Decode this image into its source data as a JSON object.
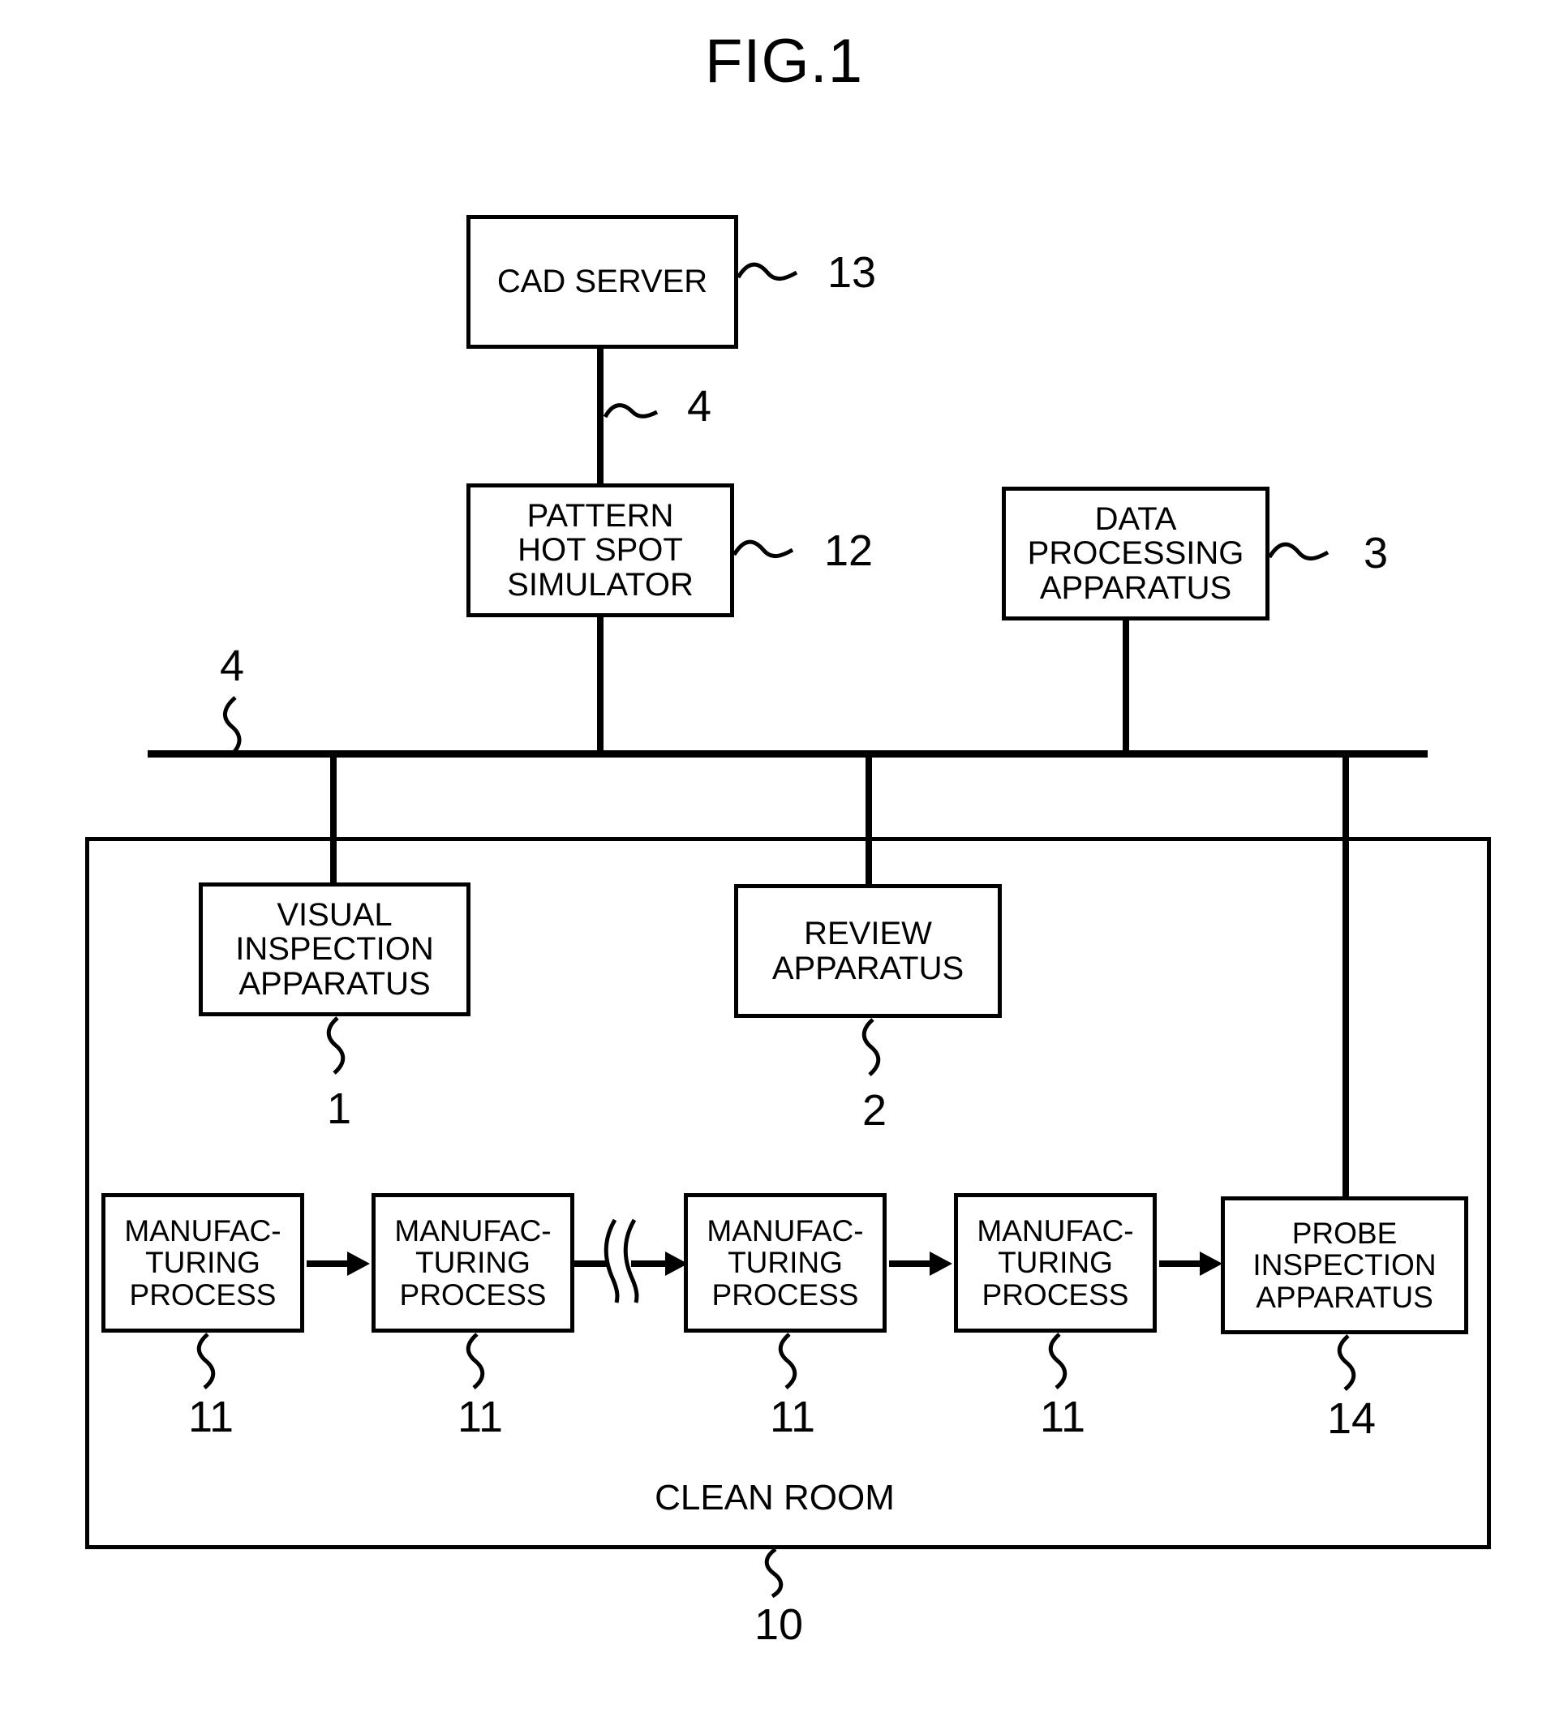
{
  "figure": {
    "title": "FIG.1"
  },
  "blocks": {
    "cad_server": {
      "lines": [
        "CAD SERVER"
      ],
      "ref": "13"
    },
    "pattern_hot_spot_simulator": {
      "lines": [
        "PATTERN",
        "HOT SPOT",
        "SIMULATOR"
      ],
      "ref": "12"
    },
    "data_processing_apparatus": {
      "lines": [
        "DATA",
        "PROCESSING",
        "APPARATUS"
      ],
      "ref": "3"
    },
    "visual_inspection_apparatus": {
      "lines": [
        "VISUAL",
        "INSPECTION",
        "APPARATUS"
      ],
      "ref": "1"
    },
    "review_apparatus": {
      "lines": [
        "REVIEW",
        "APPARATUS"
      ],
      "ref": "2"
    },
    "probe_inspection_apparatus": {
      "lines": [
        "PROBE",
        "INSPECTION",
        "APPARATUS"
      ],
      "ref": "14"
    },
    "manufacturing_process_1": {
      "lines": [
        "MANUFAC-",
        "TURING",
        "PROCESS"
      ],
      "ref": "11"
    },
    "manufacturing_process_2": {
      "lines": [
        "MANUFAC-",
        "TURING",
        "PROCESS"
      ],
      "ref": "11"
    },
    "manufacturing_process_3": {
      "lines": [
        "MANUFAC-",
        "TURING",
        "PROCESS"
      ],
      "ref": "11"
    },
    "manufacturing_process_4": {
      "lines": [
        "MANUFAC-",
        "TURING",
        "PROCESS"
      ],
      "ref": "11"
    }
  },
  "clean_room": {
    "label": "CLEAN ROOM",
    "ref": "10"
  },
  "network": {
    "upper_link_ref": "4",
    "bus_ref": "4"
  }
}
